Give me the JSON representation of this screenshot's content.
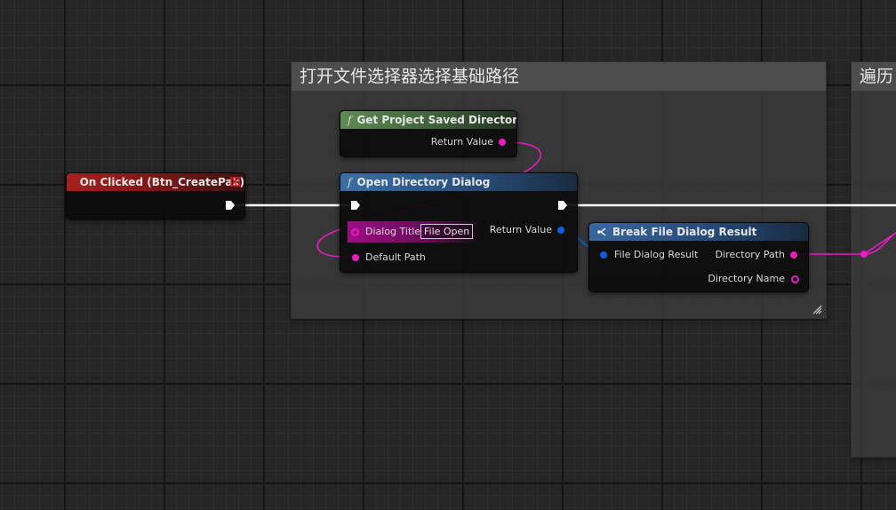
{
  "comments": {
    "select_base_path": {
      "title": "打开文件选择器选择基础路径"
    },
    "traverse": {
      "title": "遍历"
    }
  },
  "nodes": {
    "on_clicked": {
      "title": "On Clicked (Btn_CreatePak)"
    },
    "get_project_saved_directory": {
      "title": "Get Project Saved Directory",
      "return_value_label": "Return Value"
    },
    "open_directory_dialog": {
      "title": "Open Directory Dialog",
      "dialog_title_label": "Dialog Title",
      "dialog_title_value": "File Open",
      "default_path_label": "Default Path",
      "return_value_label": "Return Value"
    },
    "break_file_dialog_result": {
      "title": "Break File Dialog Result",
      "file_dialog_result_label": "File Dialog Result",
      "directory_path_label": "Directory Path",
      "directory_name_label": "Directory Name"
    }
  },
  "glyphs": {
    "function": "f"
  },
  "colors": {
    "event_header": "#a81f1f",
    "pure_function_header": "#5e8a53",
    "function_header": "#3b6ea6",
    "string_pin": "#e81cc3",
    "struct_pin": "#0f5fdc",
    "exec_wire": "#ffffff"
  },
  "icons": {
    "event": "diamond-event-icon",
    "delegate": "delegate-square-icon",
    "function": "function-f-icon",
    "break_struct": "break-struct-icon"
  }
}
